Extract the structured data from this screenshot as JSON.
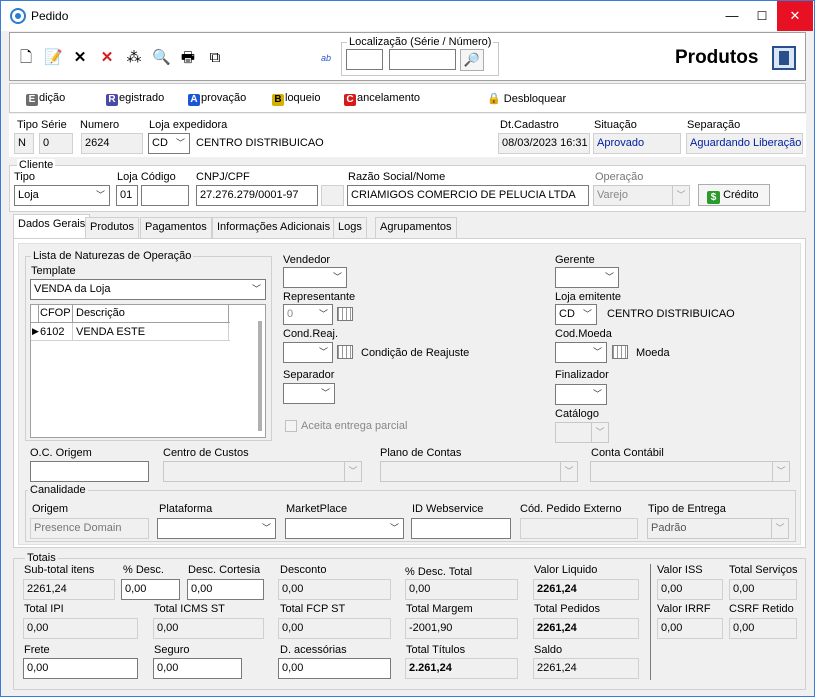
{
  "window": {
    "title": "Pedido",
    "minimize": "—",
    "maximize": "☐",
    "close": "✕"
  },
  "toolbar": {
    "icons": [
      "new-doc-icon",
      "edit-doc-icon",
      "delete-icon",
      "cancel-delete-icon",
      "magic-wand-icon",
      "preview-icon",
      "print-icon",
      "copy-icon",
      "spellcheck-icon"
    ],
    "glyphs": {
      "new": "🗋",
      "edit": "📝",
      "delete": "✕",
      "cancel": "✕",
      "wand": "⁂",
      "preview": "🔍",
      "print": "🖶",
      "copy": "⧉",
      "spell": "ab"
    },
    "localizacao_label": "Localização (Série / Número)",
    "search_glyph": "🔎",
    "produtos_label": "Produtos"
  },
  "actions": [
    {
      "key": "E",
      "label": "dição",
      "color": "#6d6d6d"
    },
    {
      "key": "R",
      "label": "egistrado",
      "color": "#4a4aa8"
    },
    {
      "key": "A",
      "label": "provação",
      "color": "#1a56d6"
    },
    {
      "key": "B",
      "label": "loqueio",
      "color": "#c7a500"
    },
    {
      "key": "C",
      "label": "ancelamento",
      "color": "#d71a1a"
    },
    {
      "key": "🔒",
      "label": "Desbloquear",
      "color": "#e0a800"
    }
  ],
  "header": {
    "tipo_serie_label": "Tipo Série",
    "tipo": "N",
    "serie": "0",
    "numero_label": "Numero",
    "numero": "2624",
    "loja_exp_label": "Loja expedidora",
    "loja_exp_code": "CD",
    "loja_exp_name": "CENTRO DISTRIBUICAO",
    "dt_label": "Dt.Cadastro",
    "dt": "08/03/2023 16:31",
    "situacao_label": "Situação",
    "situacao": "Aprovado",
    "separacao_label": "Separação",
    "separacao": "Aguardando Liberação"
  },
  "cliente": {
    "title": "Cliente",
    "tipo_label": "Tipo",
    "tipo": "Loja",
    "loja_codigo_label": "Loja Código",
    "loja": "01",
    "codigo": "",
    "cnpj_label": "CNPJ/CPF",
    "cnpj": "27.276.279/0001-97",
    "razao_label": "Razão Social/Nome",
    "razao": "CRIAMIGOS COMERCIO DE PELUCIA LTDA",
    "operacao_label": "Operação",
    "operacao": "Varejo",
    "credito_label": "Crédito"
  },
  "tabs": [
    "Dados Gerais",
    "Produtos",
    "Pagamentos",
    "Informações Adicionais",
    "Logs",
    "Agrupamentos"
  ],
  "dados_gerais": {
    "naturezas_title": "Lista de Naturezas de Operação",
    "template_label": "Template",
    "template": "VENDA da Loja",
    "grid_headers": [
      "CFOP",
      "Descrição"
    ],
    "grid_rows": [
      {
        "cfop": "6102",
        "descricao": "VENDA ESTE"
      }
    ],
    "vendedor_label": "Vendedor",
    "representante_label": "Representante",
    "representante": "0",
    "cond_reaj_label": "Cond.Reaj.",
    "cond_reaj_desc": "Condição de Reajuste",
    "separador_label": "Separador",
    "aceita_label": "Aceita entrega parcial",
    "gerente_label": "Gerente",
    "loja_emitente_label": "Loja emitente",
    "loja_emitente_code": "CD",
    "loja_emitente_name": "CENTRO DISTRIBUICAO",
    "cod_moeda_label": "Cod.Moeda",
    "moeda_desc": "Moeda",
    "finalizador_label": "Finalizador",
    "catalogo_label": "Catálogo",
    "oc_origem_label": "O.C. Origem",
    "centro_custos_label": "Centro de Custos",
    "plano_contas_label": "Plano de Contas",
    "conta_contabil_label": "Conta Contábil",
    "canalidade_title": "Canalidade",
    "origem_label": "Origem",
    "origem": "Presence Domain",
    "plataforma_label": "Plataforma",
    "marketplace_label": "MarketPlace",
    "id_webservice_label": "ID Webservice",
    "cod_pedido_externo_label": "Cód. Pedido Externo",
    "tipo_entrega_label": "Tipo de Entrega",
    "tipo_entrega": "Padrão"
  },
  "totais": {
    "title": "Totais",
    "subtotal_label": "Sub-total itens",
    "subtotal": "2261,24",
    "pdesc_label": "% Desc.",
    "pdesc": "0,00",
    "desc_cortesia_label": "Desc. Cortesia",
    "desc_cortesia": "0,00",
    "desconto_label": "Desconto",
    "desconto": "0,00",
    "pdesc_total_label": "% Desc. Total",
    "pdesc_total": "0,00",
    "valor_liquido_label": "Valor Liquido",
    "valor_liquido": "2261,24",
    "total_ipi_label": "Total IPI",
    "total_ipi": "0,00",
    "total_icms_st_label": "Total ICMS ST",
    "total_icms_st": "0,00",
    "total_fcp_st_label": "Total FCP ST",
    "total_fcp_st": "0,00",
    "total_margem_label": "Total Margem",
    "total_margem": "-2001,90",
    "total_pedidos_label": "Total Pedidos",
    "total_pedidos": "2261,24",
    "frete_label": "Frete",
    "frete": "0,00",
    "seguro_label": "Seguro",
    "seguro": "0,00",
    "d_acessorias_label": "D. acessórias",
    "d_acessorias": "0,00",
    "total_titulos_label": "Total Títulos",
    "total_titulos": "2.261,24",
    "saldo_label": "Saldo",
    "saldo": "2261,24",
    "valor_iss_label": "Valor ISS",
    "valor_iss": "0,00",
    "total_servicos_label": "Total Serviços",
    "total_servicos": "0,00",
    "valor_irrf_label": "Valor IRRF",
    "valor_irrf": "0,00",
    "csrf_label": "CSRF Retido",
    "csrf": "0,00"
  }
}
